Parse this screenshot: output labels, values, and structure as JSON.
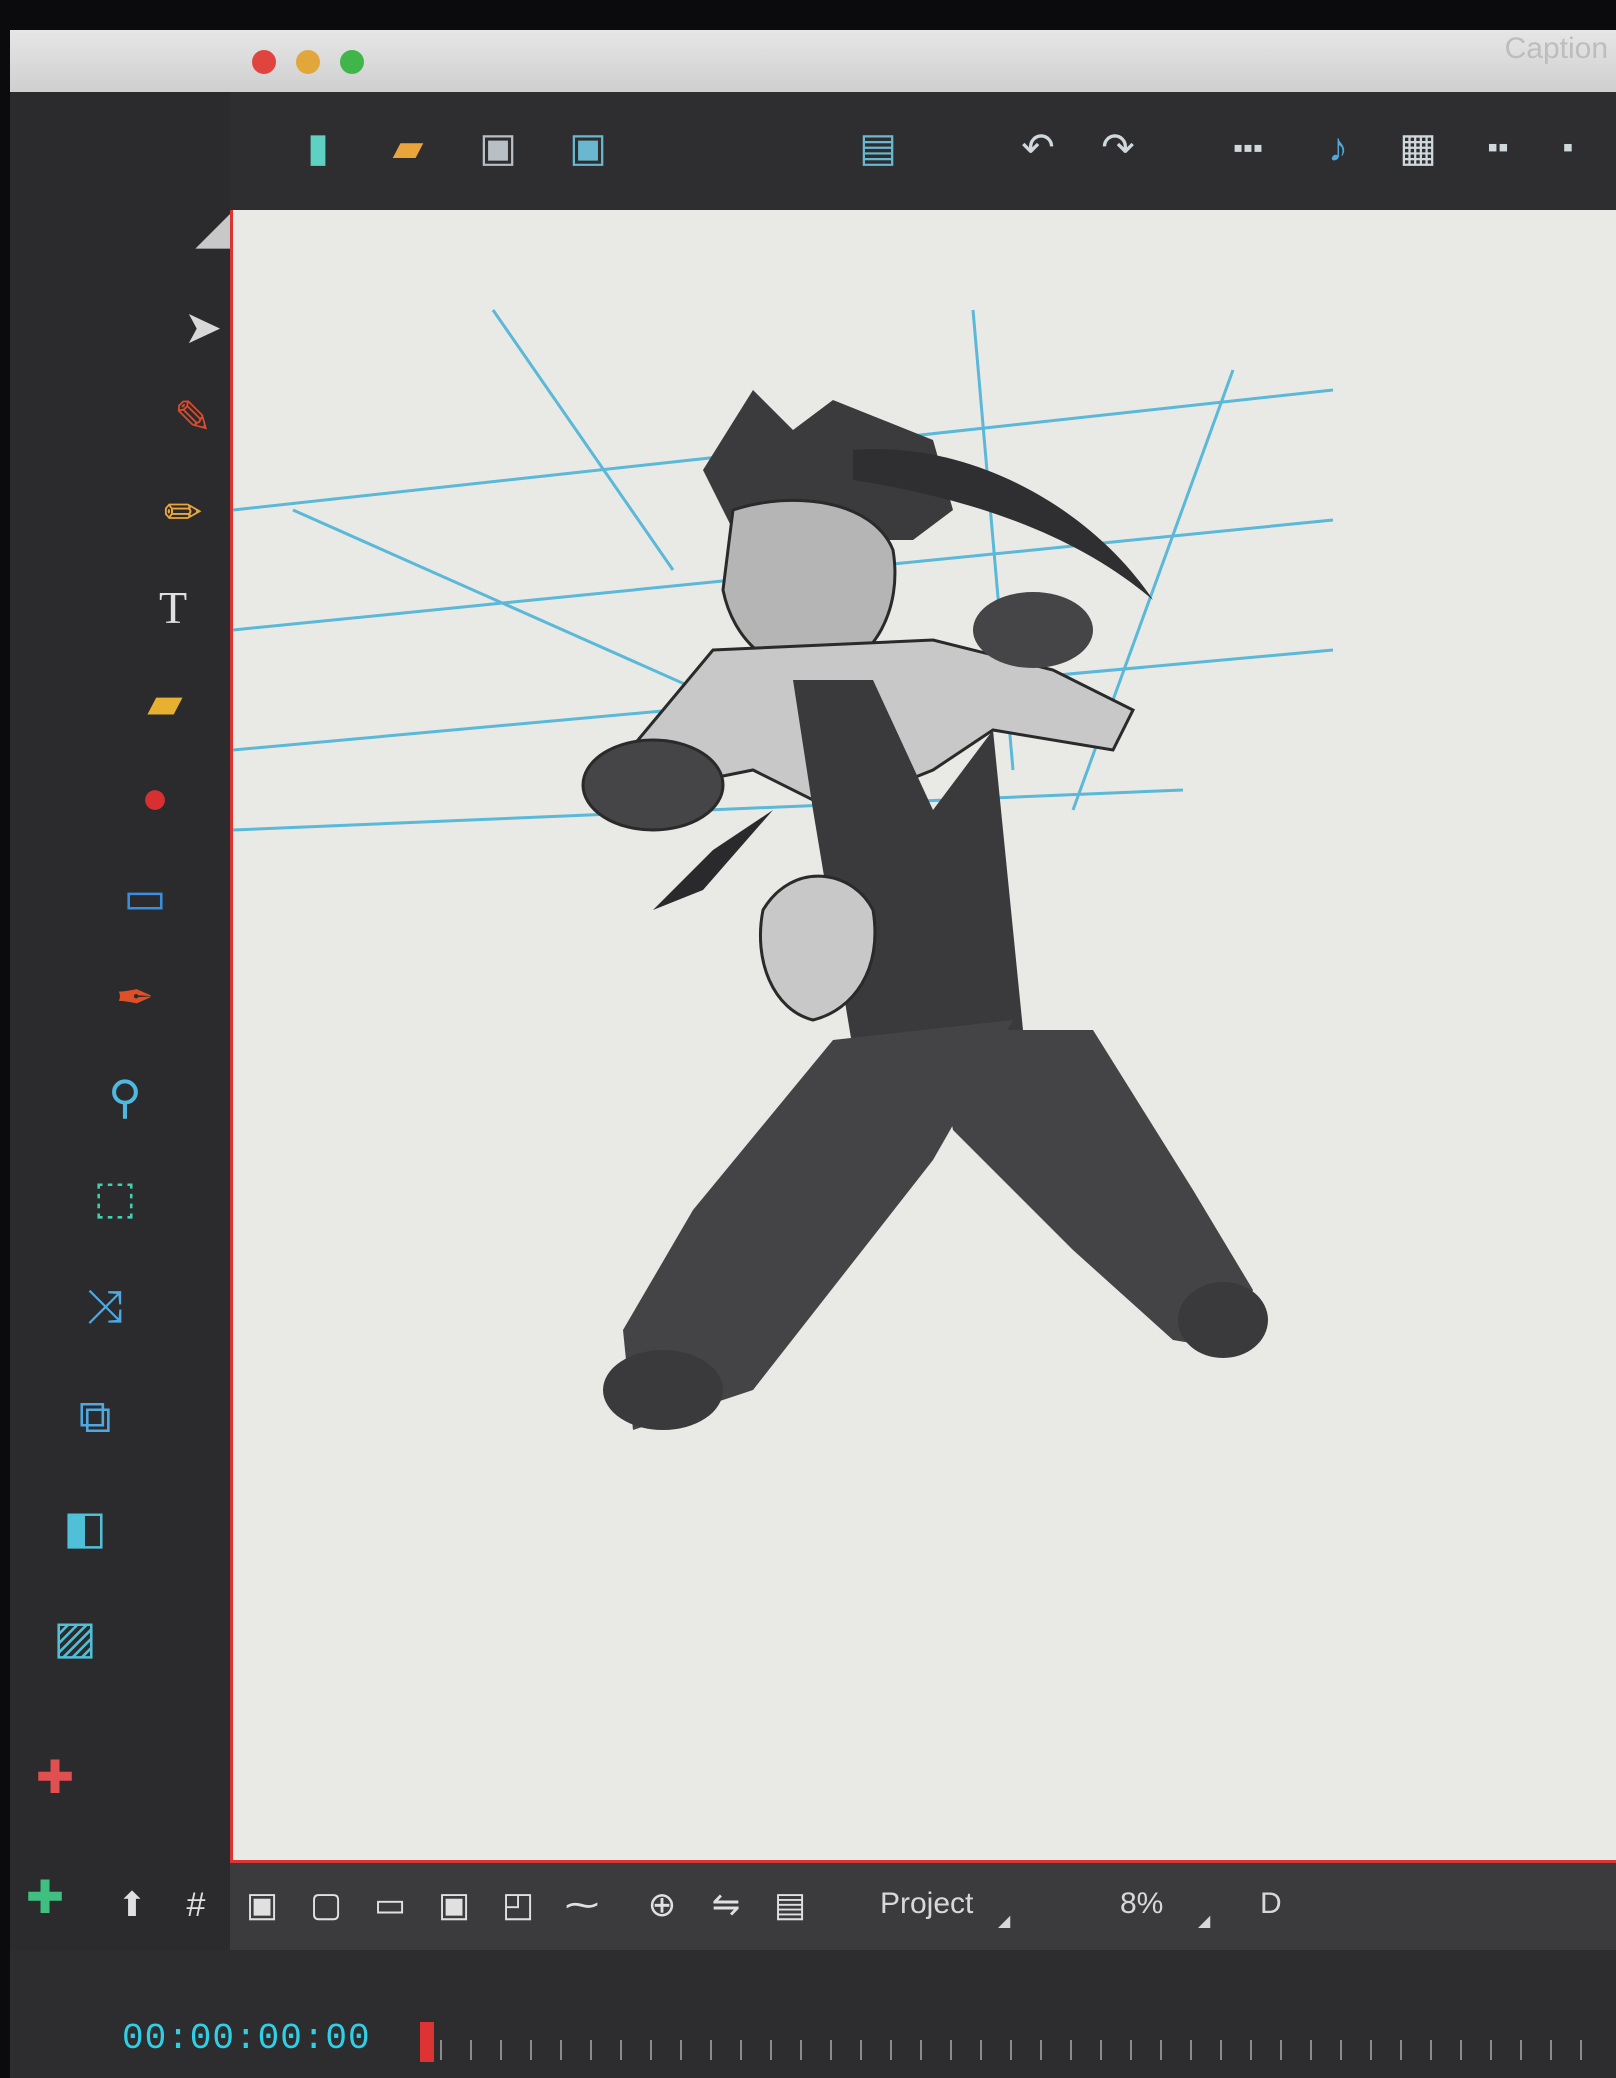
{
  "window": {
    "caption": "Caption"
  },
  "toolbar": {
    "buttons": [
      {
        "name": "new-scene-icon"
      },
      {
        "name": "open-folder-icon"
      },
      {
        "name": "save-icon"
      },
      {
        "name": "save-as-icon"
      },
      {
        "name": "paste-icon"
      },
      {
        "name": "undo-icon"
      },
      {
        "name": "redo-icon"
      },
      {
        "name": "view-mode-icons"
      }
    ]
  },
  "tools": [
    "contour-editor-icon",
    "select-arrow-icon",
    "brush-icon",
    "pencil-icon",
    "text-icon",
    "eraser-icon",
    "paint-bucket-icon",
    "rectangle-icon",
    "dropper-icon",
    "zoom-icon",
    "select-rect-icon",
    "transform-icon",
    "camera-move-icon",
    "bring-forward-icon",
    "add-layer-icon",
    "add-drawing-icon",
    "add-color-card-icon",
    "trash-icon"
  ],
  "bottombar": {
    "view_label": "Project",
    "zoom": "8%",
    "extra": "D"
  },
  "timeline": {
    "timecode": "00:00:00:00"
  },
  "colors": {
    "accent": "#dd3333",
    "timecode": "#2fd0e6",
    "canvas": "#e9e9e6",
    "perspective_lines": "#5ab8d8"
  }
}
